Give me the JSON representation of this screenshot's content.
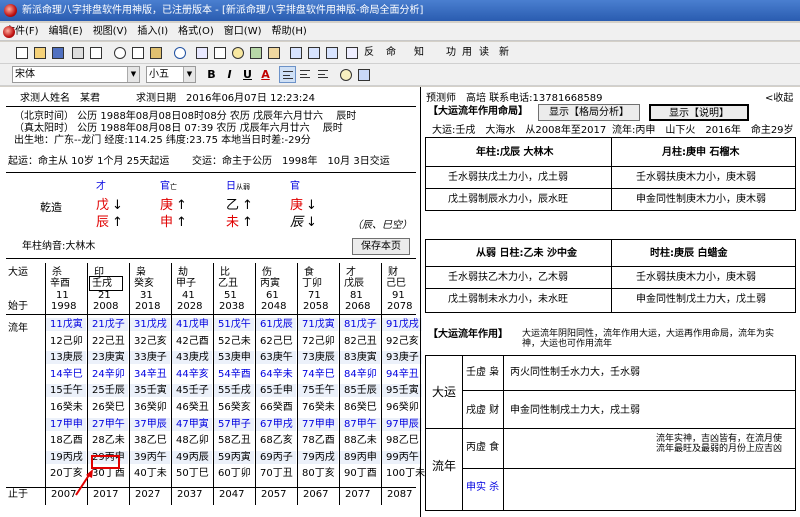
{
  "window": {
    "title": "新派命理八字排盘软件用神版，已注册版本 - [新派命理八字排盘软件用神版-命局全面分析]"
  },
  "menu": [
    "文件(F)",
    "编辑(E)",
    "视图(V)",
    "插入(I)",
    "格式(O)",
    "窗口(W)",
    "帮助(H)"
  ],
  "toolbar": {
    "t1": "反",
    "t2": "命",
    "t3": "知",
    "t4": "功",
    "t5": "用",
    "t6": "读",
    "t7": "新",
    "font": "宋体",
    "size": "小五"
  },
  "info": {
    "name": "求测人姓名　某君",
    "date": "求测日期　2016年06月07日 12:23:24",
    "l1": "（北京时间）  公历 1988年08月08日08时08分   农历 戊辰年六月廿六　 辰时",
    "l2": "（真太阳时）  公历 1988年08月08日 07:39     农历 戊辰年六月廿六　 辰时",
    "l3": "出生地：广东--龙门 经度:114.25 纬度:23.75   本地当日时差:-29分",
    "l4a": "起运：命主从  10岁 1个月  25天起运",
    "l4b": "交运：命主于公历　1998年　10月 3日交运"
  },
  "pillars": {
    "label": "乾造",
    "gods": [
      {
        "v": "才",
        "s": ""
      },
      {
        "v": "官",
        "s": "亡"
      },
      {
        "v": "日",
        "s": "从弱"
      },
      {
        "v": "官",
        "s": ""
      }
    ],
    "stems": [
      "戊",
      "庚",
      "乙",
      "庚"
    ],
    "branches": [
      "辰",
      "申",
      "未",
      "辰"
    ],
    "note": "（辰、巳空）",
    "nayin": "年柱纳音:大林木",
    "save": "保存本页"
  },
  "dayun": {
    "head": "大运",
    "start": "始于",
    "end": "止于",
    "liunian": "流年",
    "cols": [
      {
        "g": "杀",
        "gz": "辛酉",
        "a": "11",
        "y": "1998",
        "e": "2007"
      },
      {
        "g": "印",
        "gz": "壬戌",
        "a": "21",
        "y": "2008",
        "e": "2017"
      },
      {
        "g": "枭",
        "gz": "癸亥",
        "a": "31",
        "y": "2018",
        "e": "2027"
      },
      {
        "g": "劫",
        "gz": "甲子",
        "a": "41",
        "y": "2028",
        "e": "2037"
      },
      {
        "g": "比",
        "gz": "乙丑",
        "a": "51",
        "y": "2038",
        "e": "2047"
      },
      {
        "g": "伤",
        "gz": "丙寅",
        "a": "61",
        "y": "2048",
        "e": "2057"
      },
      {
        "g": "食",
        "gz": "丁卯",
        "a": "71",
        "y": "2058",
        "e": "2067"
      },
      {
        "g": "才",
        "gz": "戊辰",
        "a": "81",
        "y": "2068",
        "e": "2077"
      },
      {
        "g": "财",
        "gz": "己巳",
        "a": "91",
        "y": "2078",
        "e": "2087"
      }
    ],
    "rows": [
      [
        "11戊寅",
        "21戊子",
        "31戊戌",
        "41戊申",
        "51戊午",
        "61戊辰",
        "71戊寅",
        "81戊子",
        "91戊戌"
      ],
      [
        "12己卯",
        "22己丑",
        "32己亥",
        "42己酉",
        "52己未",
        "62己巳",
        "72己卯",
        "82己丑",
        "92己亥"
      ],
      [
        "13庚辰",
        "23庚寅",
        "33庚子",
        "43庚戌",
        "53庚申",
        "63庚午",
        "73庚辰",
        "83庚寅",
        "93庚子"
      ],
      [
        "14辛巳",
        "24辛卯",
        "34辛丑",
        "44辛亥",
        "54辛酉",
        "64辛未",
        "74辛巳",
        "84辛卯",
        "94辛丑"
      ],
      [
        "15壬午",
        "25壬辰",
        "35壬寅",
        "45壬子",
        "55壬戌",
        "65壬申",
        "75壬午",
        "85壬辰",
        "95壬寅"
      ],
      [
        "16癸未",
        "26癸巳",
        "36癸卯",
        "46癸丑",
        "56癸亥",
        "66癸酉",
        "76癸未",
        "86癸巳",
        "96癸卯"
      ],
      [
        "17甲申",
        "27甲午",
        "37甲辰",
        "47甲寅",
        "57甲子",
        "67甲戌",
        "77甲申",
        "87甲午",
        "97甲辰"
      ],
      [
        "18乙酉",
        "28乙未",
        "38乙巳",
        "48乙卯",
        "58乙丑",
        "68乙亥",
        "78乙酉",
        "88乙未",
        "98乙巳"
      ],
      [
        "19丙戌",
        "29丙申",
        "39丙午",
        "49丙辰",
        "59丙寅",
        "69丙子",
        "79丙戌",
        "89丙申",
        "99丙午"
      ],
      [
        "20丁亥",
        "30丁酉",
        "40丁未",
        "50丁巳",
        "60丁卯",
        "70丁丑",
        "80丁亥",
        "90丁酉",
        "100丁未"
      ]
    ]
  },
  "right": {
    "forecaster": "预测师　高培  联系电话:13781668589",
    "collapse": "<收起",
    "title1": "【大运流年作用命局】",
    "btn1": "显示【格局分析】",
    "btn2": "显示【说明】",
    "dayunline": "大运:壬戌　大海水　从2008年至2017",
    "liunianline": "流年:丙申　山下火　2016年　命主29岁",
    "t1h1": "年柱:戊辰  大林木",
    "t1h2": "月柱:庚申  石榴木",
    "t1c": [
      "壬水弱扶戊土力小，戊土弱",
      "壬水弱扶庚木力小，庚木弱",
      "戊土弱制辰水力小，辰水旺",
      "申金同性制庚木力小，庚木弱"
    ],
    "t2h1": "从弱  日柱:乙未  沙中金",
    "t2h2": "时柱:庚辰  白蜡金",
    "t2c": [
      "壬水弱扶乙木力小，乙木弱",
      "壬水弱扶庚木力小，庚木弱",
      "戊土弱制未水力小，未水旺",
      "申金同性制戊土力大，戊土弱"
    ],
    "title2": "【大运流年作用】",
    "desc2": "大运流年阴阳同性，流年作用大运，大运再作用命局，流年为实神，大运也可作用流年",
    "dayun": "大运",
    "liunian": "流年",
    "rows": [
      {
        "k": "壬虚 枭",
        "v": "丙火同性制壬水力大，壬水弱"
      },
      {
        "k": "戌虚 财",
        "v": "申金同性制戌土力大，戌土弱"
      },
      {
        "k": "丙虚 食",
        "v": "流年实神，吉凶皆有，在流月使流年最旺及最弱的月份上应吉凶"
      },
      {
        "k": "申实 杀",
        "v": ""
      }
    ]
  }
}
